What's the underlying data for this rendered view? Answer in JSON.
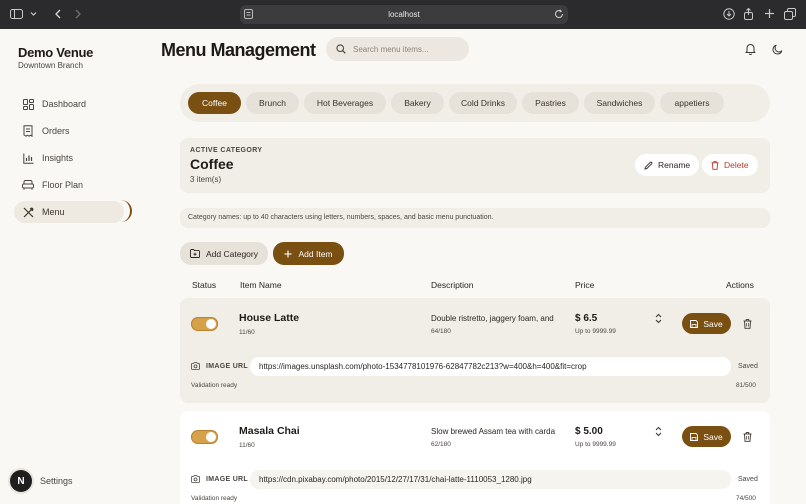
{
  "browser": {
    "url": "localhost"
  },
  "sidebar": {
    "brand": "Demo Venue",
    "branch": "Downtown Branch",
    "items": [
      {
        "label": "Dashboard",
        "icon": "dashboard-icon"
      },
      {
        "label": "Orders",
        "icon": "receipt-icon"
      },
      {
        "label": "Insights",
        "icon": "chart-icon"
      },
      {
        "label": "Floor Plan",
        "icon": "sofa-icon"
      },
      {
        "label": "Menu",
        "icon": "utensils-icon",
        "active": true
      }
    ],
    "settings_label": "Settings",
    "avatar_initial": "N"
  },
  "header": {
    "title": "Menu Management",
    "search_placeholder": "Search menu items..."
  },
  "categories": {
    "tabs": [
      "Coffee",
      "Brunch",
      "Hot Beverages",
      "Bakery",
      "Cold Drinks",
      "Pastries",
      "Sandwiches",
      "appetiers"
    ],
    "active": "Coffee"
  },
  "active_category": {
    "label": "ACTIVE CATEGORY",
    "name": "Coffee",
    "count": "3 item(s)",
    "rename_label": "Rename",
    "delete_label": "Delete"
  },
  "hint": "Category names: up to 40 characters using letters, numbers, spaces, and basic menu punctuation.",
  "actions": {
    "add_category_label": "Add Category",
    "add_item_label": "Add Item"
  },
  "table": {
    "columns": [
      "Status",
      "Item Name",
      "Description",
      "Price",
      "Actions"
    ],
    "rows": [
      {
        "enabled": true,
        "name": "House Latte",
        "name_count": "11/60",
        "description": "Double ristretto, jaggery foam, and",
        "description_count": "64/180",
        "price": "$ 6.5",
        "price_limit": "Up to 9999.99",
        "save_label": "Save",
        "image_label": "IMAGE URL",
        "image_url": "https://images.unsplash.com/photo-1534778101976-62847782c213?w=400&h=400&fit=crop",
        "saved_status": "Saved",
        "validation": "Validation ready",
        "url_count": "81/500"
      },
      {
        "enabled": true,
        "name": "Masala Chai",
        "name_count": "11/60",
        "description": "Slow brewed Assam tea with carda",
        "description_count": "62/180",
        "price": "$ 5.00",
        "price_limit": "Up to 9999.99",
        "save_label": "Save",
        "image_label": "IMAGE URL",
        "image_url": "https://cdn.pixabay.com/photo/2015/12/27/17/31/chai-latte-1110053_1280.jpg",
        "saved_status": "Saved",
        "validation": "Validation ready",
        "url_count": "74/500"
      }
    ]
  },
  "colors": {
    "accent": "#7a4f12",
    "toggle_on": "#d7a14a",
    "delete": "#c0392b",
    "background": "#faf8f4",
    "panel": "#f1eee8"
  }
}
